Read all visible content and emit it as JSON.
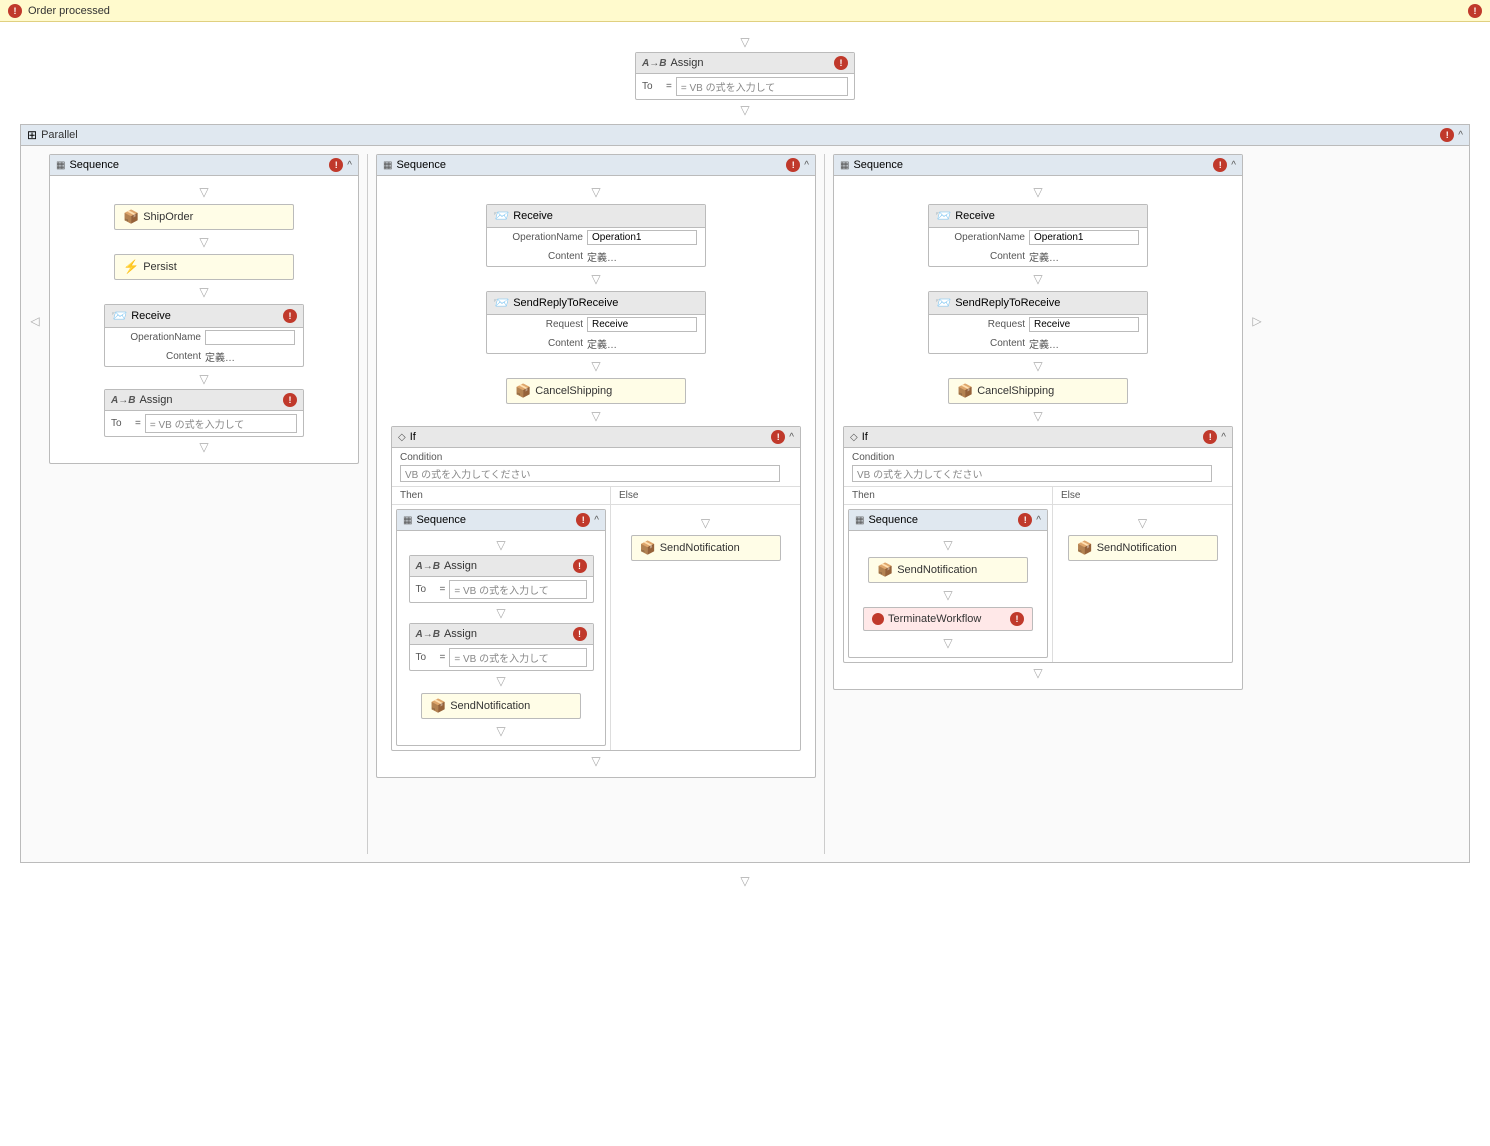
{
  "topBar": {
    "title": "Order processed",
    "errorBadge": "!"
  },
  "canvas": {
    "topAssign": {
      "label": "Assign",
      "iconText": "A→B",
      "toLabel": "To",
      "inputValue": "= VB の式を入力して",
      "errorBadge": "!"
    },
    "parallel": {
      "label": "Parallel",
      "errorBadge": "!",
      "collapseIcon": "^",
      "leftSequence": {
        "label": "Sequence",
        "errorBadge": "!",
        "collapseIcon": "^",
        "shipOrder": {
          "label": "ShipOrder",
          "icon": "📦"
        },
        "persist": {
          "label": "Persist",
          "icon": "⚡"
        },
        "receive": {
          "label": "Receive",
          "icon": "📨",
          "operationNameLabel": "OperationName",
          "operationNameValue": "",
          "contentLabel": "Content",
          "contentValue": "定義…",
          "errorBadge": "!"
        },
        "assign": {
          "label": "Assign",
          "iconText": "A→B",
          "toLabel": "To",
          "inputValue": "= VB の式を入力して",
          "errorBadge": "!"
        }
      },
      "middleSequence": {
        "label": "Sequence",
        "errorBadge": "!",
        "collapseIcon": "^",
        "receive": {
          "label": "Receive",
          "icon": "📨",
          "operationNameLabel": "OperationName",
          "operationNameValue": "Operation1",
          "contentLabel": "Content",
          "contentValue": "定義…"
        },
        "sendReply": {
          "label": "SendReplyToReceive",
          "icon": "📨",
          "requestLabel": "Request",
          "requestValue": "Receive",
          "contentLabel": "Content",
          "contentValue": "定義…"
        },
        "cancelShipping": {
          "label": "CancelShipping",
          "icon": "📦"
        },
        "ifActivity": {
          "label": "If",
          "errorBadge": "!",
          "collapseIcon": "^",
          "conditionLabel": "Condition",
          "conditionValue": "VB の式を入力してください",
          "thenLabel": "Then",
          "elseLabel": "Else",
          "thenSequence": {
            "label": "Sequence",
            "errorBadge": "!",
            "collapseIcon": "^",
            "assign1": {
              "label": "Assign",
              "iconText": "A→B",
              "toLabel": "To",
              "inputValue": "= VB の式を入力して",
              "errorBadge": "!"
            },
            "assign2": {
              "label": "Assign",
              "iconText": "A→B",
              "toLabel": "To",
              "inputValue": "= VB の式を入力して",
              "errorBadge": "!"
            },
            "sendNotification": {
              "label": "SendNotification",
              "icon": "📦"
            }
          },
          "elseContent": {
            "sendNotification": {
              "label": "SendNotification",
              "icon": "📦"
            }
          }
        }
      },
      "rightSequence": {
        "label": "Sequence",
        "errorBadge": "!",
        "collapseIcon": "^",
        "receive": {
          "label": "Receive",
          "icon": "📨",
          "operationNameLabel": "OperationName",
          "operationNameValue": "Operation1",
          "contentLabel": "Content",
          "contentValue": "定義…"
        },
        "sendReply": {
          "label": "SendReplyToReceive",
          "icon": "📨",
          "requestLabel": "Request",
          "requestValue": "Receive",
          "contentLabel": "Content",
          "contentValue": "定義…"
        },
        "cancelShipping": {
          "label": "CancelShipping",
          "icon": "📦"
        },
        "ifActivity": {
          "label": "If",
          "errorBadge": "!",
          "collapseIcon": "^",
          "conditionLabel": "Condition",
          "conditionValue": "VB の式を入力してください",
          "thenLabel": "Then",
          "elseLabel": "Else",
          "thenSequence": {
            "label": "Sequence",
            "errorBadge": "!",
            "collapseIcon": "^",
            "sendNotification": {
              "label": "SendNotification",
              "icon": "📦"
            },
            "terminateWorkflow": {
              "label": "TerminateWorkflow",
              "errorBadge": "!"
            }
          },
          "elseContent": {
            "sendNotification": {
              "label": "SendNotification",
              "icon": "📦"
            }
          }
        }
      }
    }
  },
  "icons": {
    "arrowDown": "▽",
    "arrowLeft": "◁",
    "arrowRight": "▷",
    "collapse": "∧",
    "error": "!",
    "shipOrderIcon": "🟡",
    "persistIcon": "⚡",
    "receiveIcon": "🟡",
    "sendIcon": "🟡",
    "cancelIcon": "🟡",
    "sendNotifIcon": "🟡",
    "terminateIcon": "●"
  }
}
